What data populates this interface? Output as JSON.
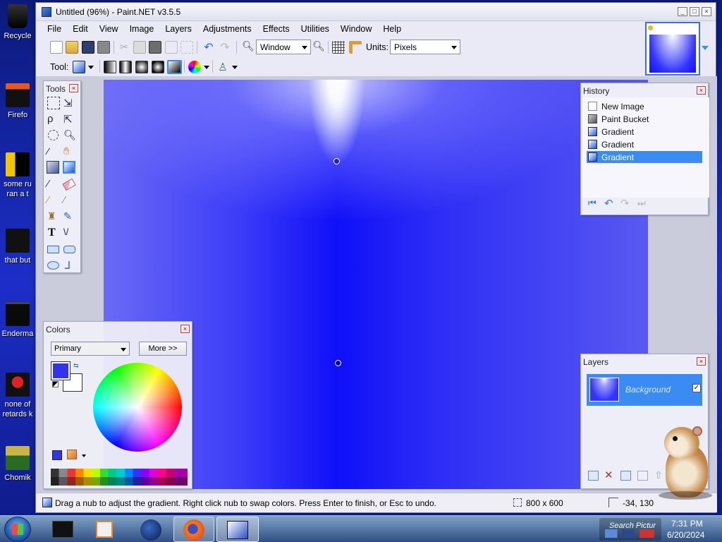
{
  "desktop": {
    "icons": [
      {
        "label": "Recycle"
      },
      {
        "label": "Firefo"
      },
      {
        "label": "some ru"
      },
      {
        "label": "ran a t"
      },
      {
        "label": "that but"
      },
      {
        "label": "Enderma"
      },
      {
        "label": "none of"
      },
      {
        "label": "retards k"
      },
      {
        "label": "Chomik"
      }
    ]
  },
  "window": {
    "title": "Untitled (96%) - Paint.NET v3.5.5",
    "controls": {
      "minimize": "_",
      "maximize": "□",
      "close": "×"
    }
  },
  "menu": [
    "File",
    "Edit",
    "View",
    "Image",
    "Layers",
    "Adjustments",
    "Effects",
    "Utilities",
    "Window",
    "Help"
  ],
  "toolbar1": {
    "zoom_value": "Window",
    "units_label": "Units:",
    "units_value": "Pixels"
  },
  "toolbar2": {
    "tool_label": "Tool:"
  },
  "tools_panel": {
    "title": "Tools"
  },
  "history_panel": {
    "title": "History",
    "items": [
      {
        "label": "New Image",
        "icon": "new-image-icon"
      },
      {
        "label": "Paint Bucket",
        "icon": "paint-bucket-icon"
      },
      {
        "label": "Gradient",
        "icon": "gradient-icon"
      },
      {
        "label": "Gradient",
        "icon": "gradient-icon"
      },
      {
        "label": "Gradient",
        "icon": "gradient-icon",
        "selected": true
      }
    ]
  },
  "colors_panel": {
    "title": "Colors",
    "mode": "Primary",
    "more_button": "More >>",
    "primary_color": "#3333ee",
    "secondary_color": "#ffffff"
  },
  "layers_panel": {
    "title": "Layers",
    "layer_name": "Background",
    "layer_visible": true
  },
  "statusbar": {
    "hint": "Drag a nub to adjust the gradient. Right click nub to swap colors. Press Enter to finish, or Esc to undo.",
    "image_size": "800 x 600",
    "cursor_pos": "-34, 130"
  },
  "taskbar": {
    "time": "7:31 PM",
    "date": "6/20/2024",
    "tray_text": "Search Pictur"
  }
}
